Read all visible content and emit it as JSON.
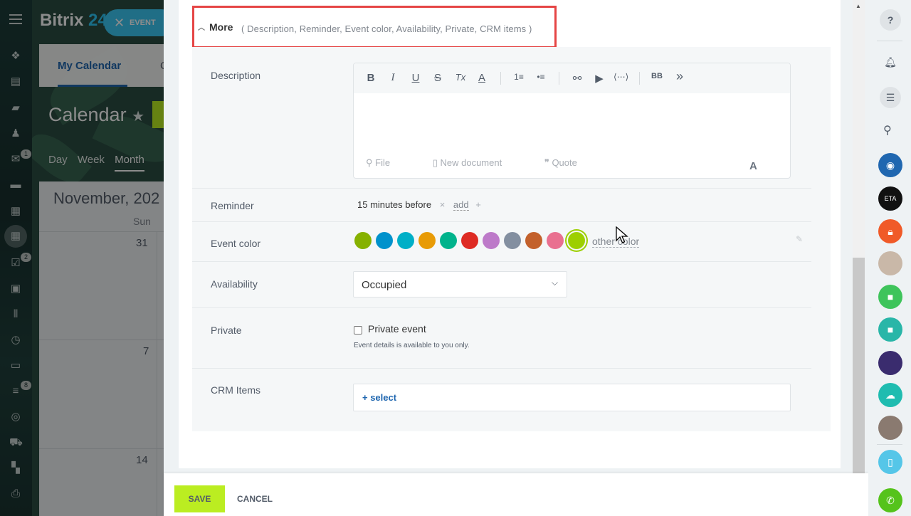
{
  "app": {
    "logo_text": "Bitrix",
    "logo_num": "24"
  },
  "left_sidebar": {
    "badges": {
      "mail": "1",
      "tasks": "2",
      "feed": "8"
    },
    "icons": [
      "sitemap-icon",
      "stream-icon",
      "chat-icon",
      "people-icon",
      "mail-icon",
      "inbox-icon",
      "document-icon",
      "calendar-icon",
      "tasks-icon",
      "contacts-icon",
      "kanban-icon",
      "clock-icon",
      "window-icon",
      "filter-icon",
      "target-icon",
      "cart-icon",
      "apps-icon",
      "printer-icon"
    ]
  },
  "background": {
    "event_button": "EVENT",
    "tab_my_calendar": "My Calendar",
    "tab_partial": "C",
    "title": "Calendar",
    "views": [
      "Day",
      "Week",
      "Month"
    ],
    "month_label": "November, 202",
    "dow": "Sun",
    "days": [
      "31",
      "7",
      "14"
    ]
  },
  "more": {
    "label": "More",
    "summary": "( Description,  Reminder,  Event color,  Availability,  Private,  CRM items )"
  },
  "description": {
    "label": "Description",
    "toolbar": [
      "B",
      "I",
      "U",
      "S",
      "Tx",
      "A",
      "1≡",
      "•≡",
      "link",
      "video",
      "code",
      "BB",
      "»"
    ],
    "footer": {
      "file": "File",
      "new_document": "New document",
      "quote": "Quote"
    },
    "font_button": "A"
  },
  "reminder": {
    "label": "Reminder",
    "value": "15 minutes before",
    "remove": "×",
    "add": "add",
    "plus": "+"
  },
  "event_color": {
    "label": "Event color",
    "colors": [
      "#86b100",
      "#0092cc",
      "#00afc7",
      "#e89b06",
      "#00b38c",
      "#de2b24",
      "#bd7ac9",
      "#838fa0",
      "#c3612c",
      "#e97090",
      "#9dcf00"
    ],
    "selected_index": 10,
    "other": "other color"
  },
  "availability": {
    "label": "Availability",
    "value": "Occupied"
  },
  "private": {
    "label": "Private",
    "checkbox_label": "Private event",
    "hint": "Event details is available to you only."
  },
  "crm": {
    "label": "CRM Items",
    "select": "+ select"
  },
  "footer": {
    "save": "SAVE",
    "cancel": "CANCEL"
  },
  "right_bar": {
    "help": "?",
    "items": [
      "bell-icon",
      "chat-bubble-icon",
      "search-icon",
      "group-chat-avatar",
      "fusion-eta-avatar",
      "lock-avatar",
      "photo-avatar",
      "video-call-icon",
      "video-call-icon-2",
      "concert-avatar",
      "cloud-clock-icon",
      "man-avatar",
      "device-icon",
      "phone-icon"
    ]
  }
}
